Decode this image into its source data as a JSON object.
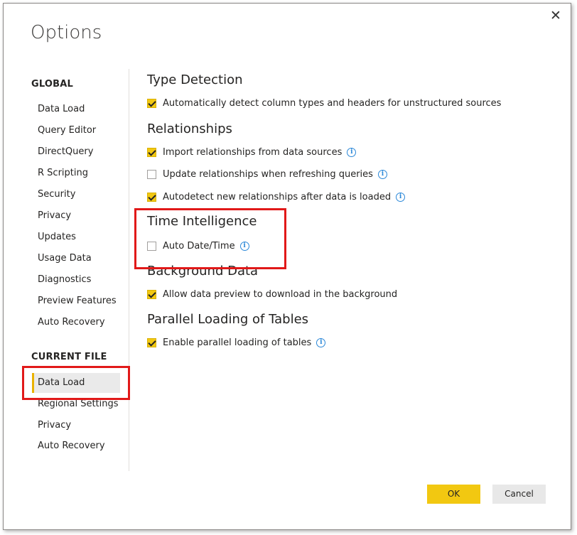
{
  "dialog": {
    "title": "Options",
    "close_glyph": "✕"
  },
  "sidebar": {
    "global_heading": "GLOBAL",
    "global_items": [
      {
        "label": "Data Load"
      },
      {
        "label": "Query Editor"
      },
      {
        "label": "DirectQuery"
      },
      {
        "label": "R Scripting"
      },
      {
        "label": "Security"
      },
      {
        "label": "Privacy"
      },
      {
        "label": "Updates"
      },
      {
        "label": "Usage Data"
      },
      {
        "label": "Diagnostics"
      },
      {
        "label": "Preview Features"
      },
      {
        "label": "Auto Recovery"
      }
    ],
    "current_heading": "CURRENT FILE",
    "current_items": [
      {
        "label": "Data Load",
        "selected": true
      },
      {
        "label": "Regional Settings"
      },
      {
        "label": "Privacy"
      },
      {
        "label": "Auto Recovery"
      }
    ]
  },
  "main": {
    "type_detection": {
      "title": "Type Detection",
      "opt1": {
        "label": "Automatically detect column types and headers for unstructured sources",
        "checked": true
      }
    },
    "relationships": {
      "title": "Relationships",
      "opt1": {
        "label": "Import relationships from data sources",
        "checked": true
      },
      "opt2": {
        "label": "Update relationships when refreshing queries",
        "checked": false
      },
      "opt3": {
        "label": "Autodetect new relationships after data is loaded",
        "checked": true
      }
    },
    "time_intelligence": {
      "title": "Time Intelligence",
      "opt1": {
        "label": "Auto Date/Time",
        "checked": false
      }
    },
    "background_data": {
      "title": "Background Data",
      "opt1": {
        "label": "Allow data preview to download in the background",
        "checked": true
      }
    },
    "parallel_loading": {
      "title": "Parallel Loading of Tables",
      "opt1": {
        "label": "Enable parallel loading of tables",
        "checked": true
      }
    }
  },
  "footer": {
    "ok_label": "OK",
    "cancel_label": "Cancel"
  },
  "icons": {
    "info": "i",
    "checkmark": "checkmark-icon"
  },
  "colors": {
    "accent": "#f2c811",
    "highlight_box": "#e11919",
    "info_icon": "#2b88d8"
  }
}
